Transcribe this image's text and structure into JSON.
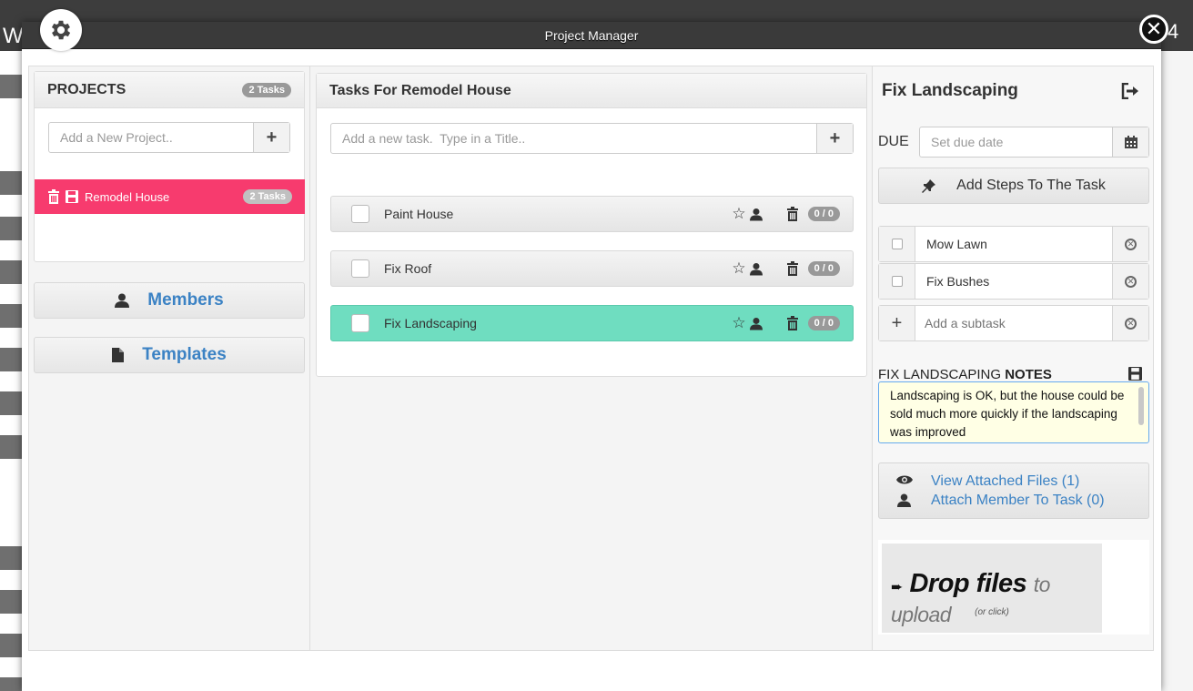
{
  "window": {
    "title": "Project Manager"
  },
  "projects": {
    "header": "PROJECTS",
    "count_badge": "2 Tasks",
    "add_placeholder": "Add a New Project..",
    "items": [
      {
        "name": "Remodel House",
        "badge": "2 Tasks",
        "color": "#f73b6e"
      }
    ]
  },
  "sidebar": {
    "members_label": "Members",
    "templates_label": "Templates"
  },
  "tasks": {
    "header": "Tasks For Remodel House",
    "add_placeholder": "Add a new task.  Type in a Title..",
    "items": [
      {
        "title": "Paint House",
        "progress": "0 / 0"
      },
      {
        "title": "Fix Roof",
        "progress": "0 / 0"
      },
      {
        "title": "Fix Landscaping",
        "progress": "0 / 0",
        "active_color": "#6fddc0"
      }
    ]
  },
  "detail": {
    "title": "Fix Landscaping",
    "due_label": "DUE",
    "due_placeholder": "Set due date",
    "add_steps_label": "Add Steps To The Task",
    "subtasks": [
      {
        "title": "Mow Lawn"
      },
      {
        "title": "Fix Bushes"
      }
    ],
    "add_subtask_placeholder": "Add a subtask",
    "notes_title": "FIX LANDSCAPING",
    "notes_title_bold": "NOTES",
    "notes_text": "Landscaping is OK, but the house could be sold much more quickly if the landscaping was improved",
    "view_files_label": "View Attached Files (1)",
    "attach_member_label": "Attach Member To Task (0)",
    "drop_bold": "Drop files",
    "drop_light": "to upload",
    "drop_sub": "(or click)"
  },
  "background": {
    "left_letter": "W",
    "right_digit": "4"
  }
}
